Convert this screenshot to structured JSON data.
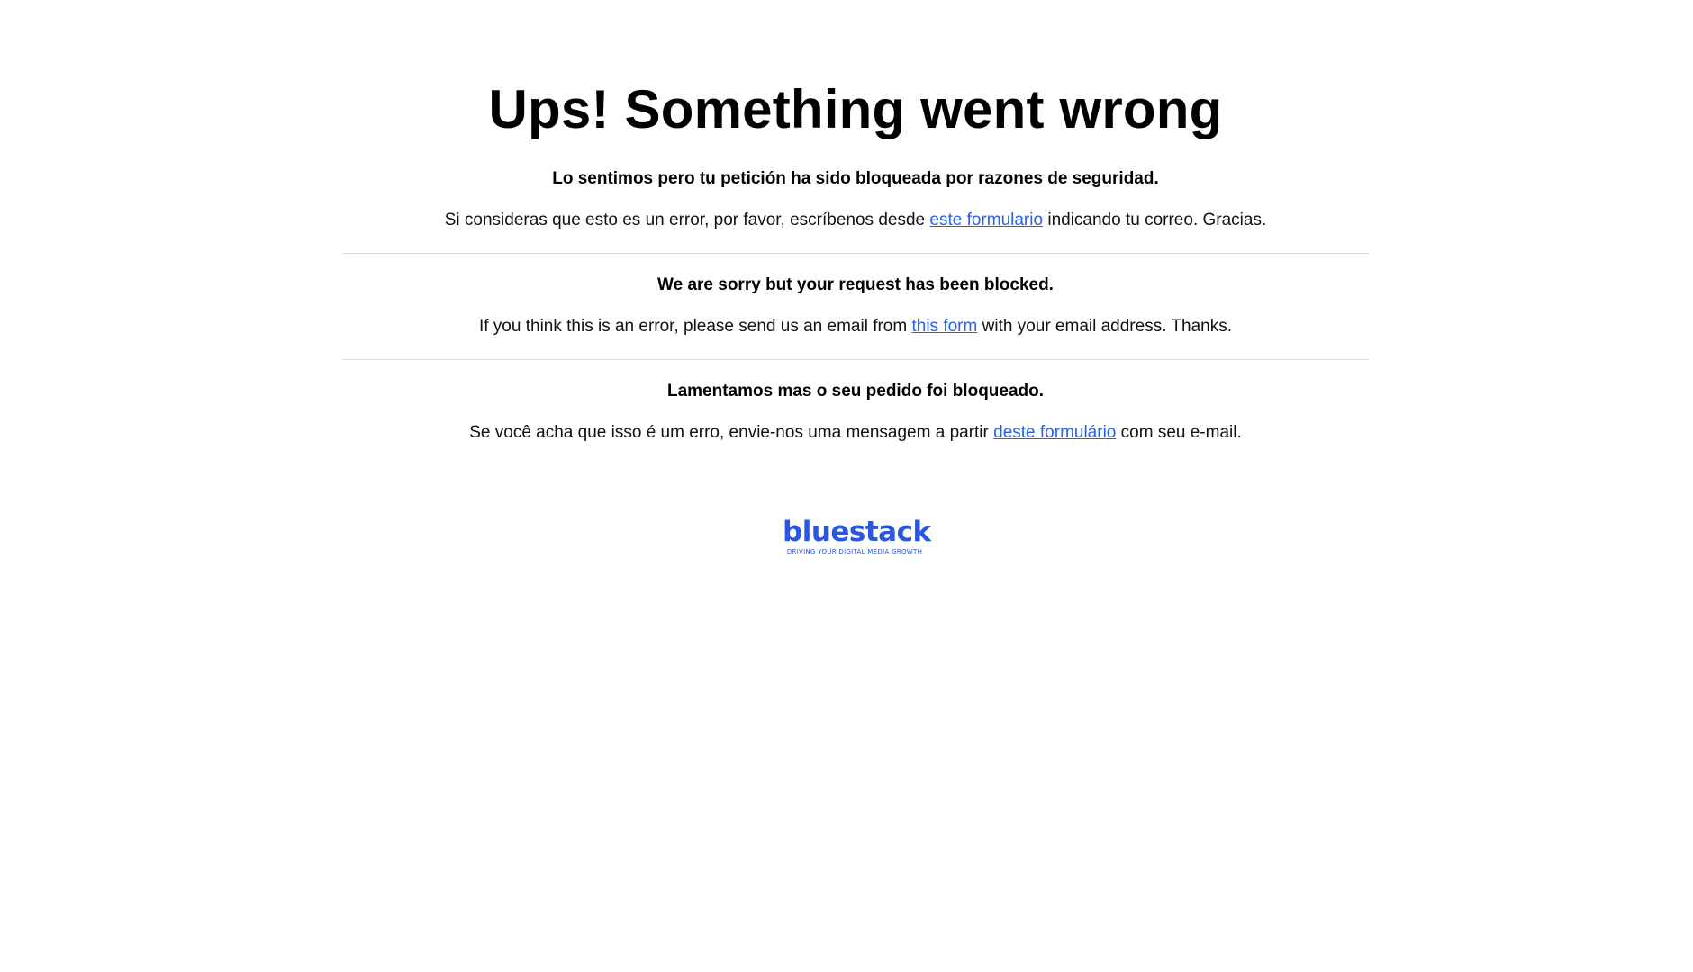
{
  "page": {
    "title": "Ups! Something went wrong"
  },
  "sections": [
    {
      "lang": "es",
      "headline": "Lo sentimos pero tu petición ha sido bloqueada por razones de seguridad.",
      "text_before": "Si consideras que esto es un error, por favor, escríbenos desde ",
      "link_text": "este formulario",
      "text_after": " indicando tu correo. Gracias."
    },
    {
      "lang": "en",
      "headline": "We are sorry but your request has been blocked.",
      "text_before": "If you think this is an error, please send us an email from ",
      "link_text": "this form",
      "text_after": " with your email address. Thanks."
    },
    {
      "lang": "pt",
      "headline": "Lamentamos mas o seu pedido foi bloqueado.",
      "text_before": "Se você acha que isso é um erro, envie-nos uma mensagem a partir ",
      "link_text": "deste formulário",
      "text_after": " com seu e-mail."
    }
  ],
  "logo": {
    "wordmark": "bluestack",
    "tagline": "DRIVING YOUR DIGITAL MEDIA GROWTH"
  },
  "colors": {
    "link": "#2a5fe6",
    "brand": "#2a56e0",
    "divider": "#dcdcdc"
  }
}
